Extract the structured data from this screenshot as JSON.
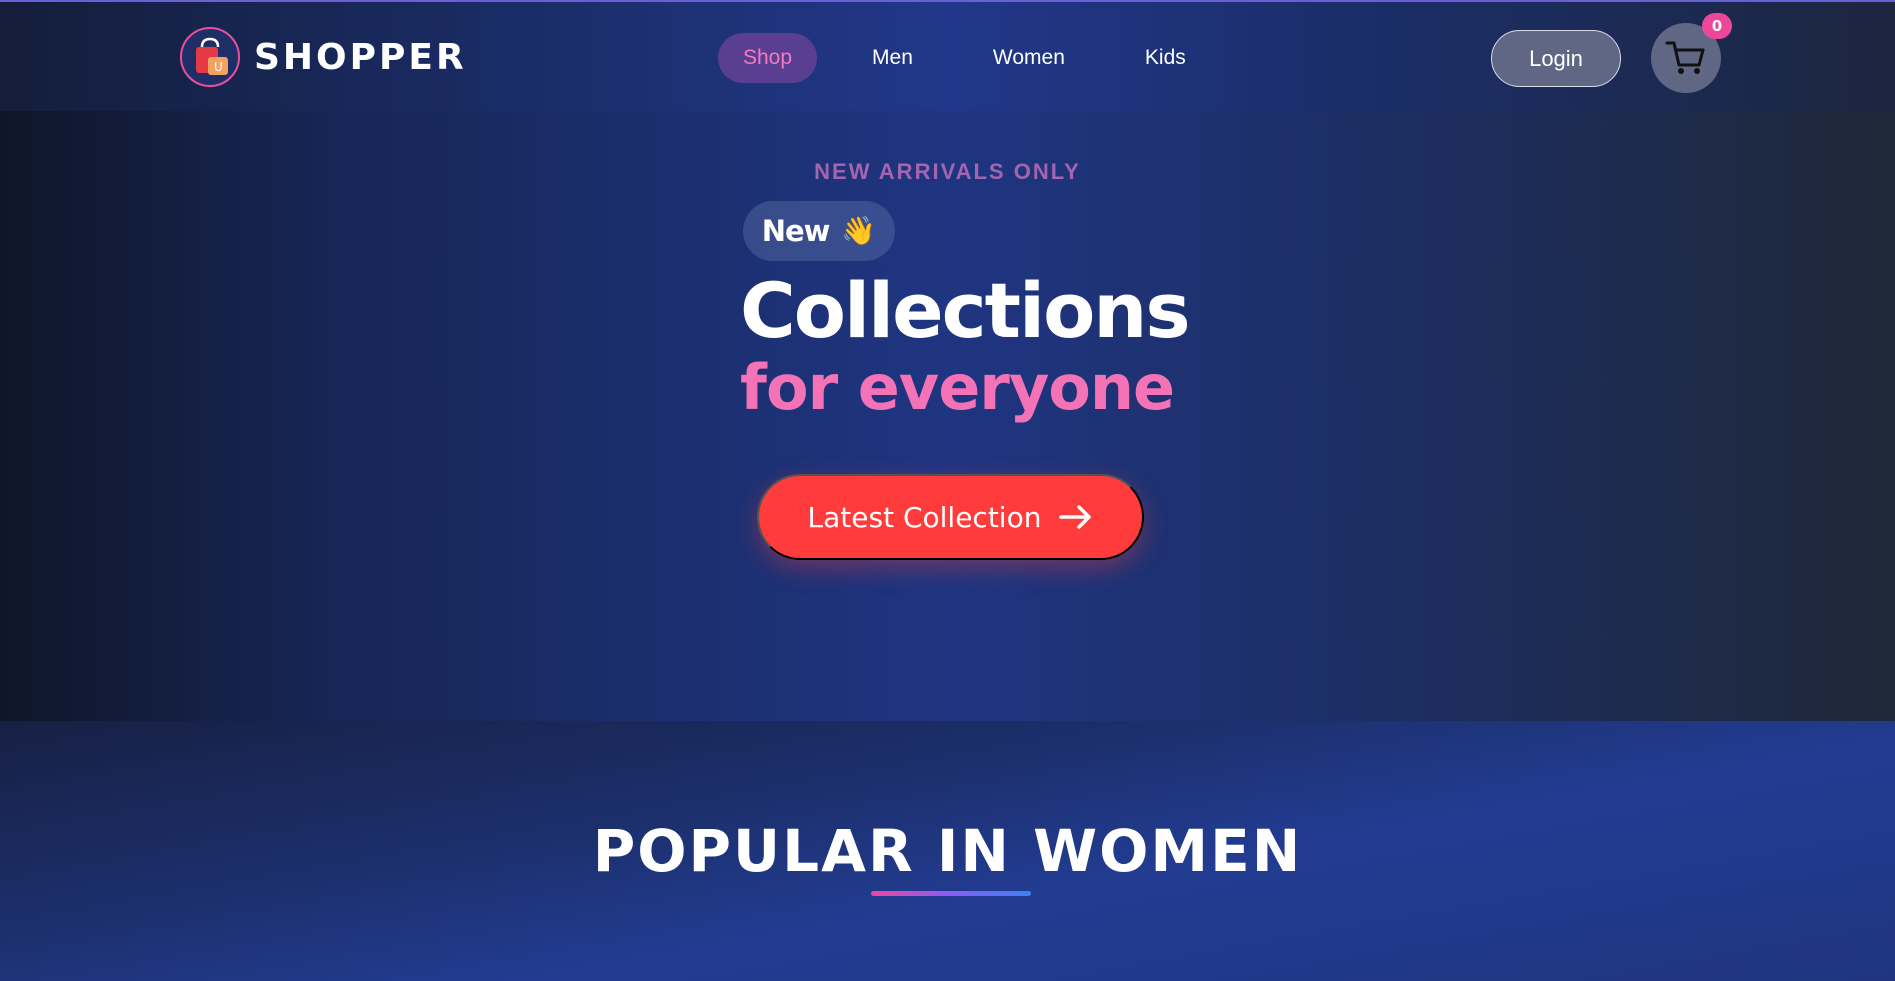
{
  "brand": {
    "name": "SHOPPER",
    "logo_letter": "U"
  },
  "nav": {
    "items": [
      {
        "label": "Shop",
        "active": true
      },
      {
        "label": "Men"
      },
      {
        "label": "Women"
      },
      {
        "label": "Kids"
      }
    ]
  },
  "header": {
    "login_label": "Login",
    "cart_count": "0"
  },
  "hero": {
    "kicker": "NEW ARRIVALS ONLY",
    "pill_label": "New",
    "pill_emoji": "👋",
    "title": "Collections",
    "subtitle": "for everyone",
    "cta_label": "Latest Collection"
  },
  "popular": {
    "title": "POPULAR IN WOMEN"
  },
  "colors": {
    "accent_pink": "#f472b6",
    "cta_red": "#ff3b3b",
    "badge_pink": "#ec4899",
    "kicker_purple": "#a365b0"
  },
  "icons": {
    "logo": "shopping-bag-icon",
    "cart": "cart-icon",
    "cta_arrow": "arrow-right-icon",
    "pill": "waving-hand-icon"
  }
}
